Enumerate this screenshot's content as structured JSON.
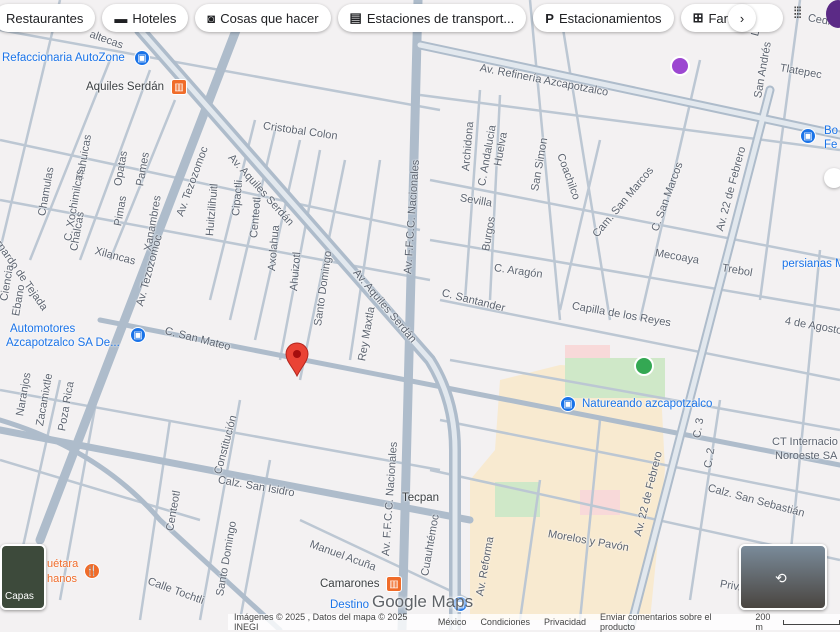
{
  "chips": [
    {
      "icon": "restaurant-icon",
      "label": "Restaurantes"
    },
    {
      "icon": "bed-icon",
      "label": "Hoteles"
    },
    {
      "icon": "camera-icon",
      "label": "Cosas que hacer"
    },
    {
      "icon": "train-icon",
      "label": "Estaciones de transport..."
    },
    {
      "icon": "parking-icon",
      "label": "Estacionamientos"
    },
    {
      "icon": "pharmacy-icon",
      "label": "Farmac"
    }
  ],
  "labels": [
    "Refaccionaria AutoZone",
    "Aquiles Serdán",
    "Cristobal Colon",
    "Av. Tezozomoc",
    "Av. Aquiles Serdán",
    "Huitzilihuitl",
    "Cipactli",
    "Centeotl",
    "Axolahua",
    "Ahuizotl",
    "Santo Domingo",
    "Tlahuicas",
    "Chamulas",
    "C. Xochimilcas",
    "Opatas",
    "Pames",
    "Pimas",
    "Chalcas",
    "Xanambres",
    "Xilancas",
    "Av. Tezozomoc",
    "Ebano",
    "Bernardo de Tejada",
    "Ciencia",
    "Automotores",
    "Azcapotzalco SA De...",
    "C. San Mateo",
    "Rey Maxtla",
    "Av. Aquiles Serdán",
    "Av. F.F.C.C. Nacionales",
    "Archidona",
    "C. Andalucia",
    "Huelva",
    "San Simon",
    "Coachilco",
    "Sevilla",
    "Burgos",
    "C. Aragón",
    "C. Santander",
    "Capilla de los Reyes",
    "Cam. San Marcos",
    "C. San Marcos",
    "Mecoaya",
    "Trebol",
    "Av. 22 de Febrero",
    "persianas M",
    "4 de Agosto",
    "Av. Refinería Azcapotzalco",
    "Tlatepec",
    "San Andrés",
    "La Era",
    "Bo",
    "Fe",
    "Natureando azcapotzalco",
    "CT Internacio",
    "Noroeste SA",
    "C. 3",
    "C. 2",
    "Calz. San Sebastián",
    "Morelos y Pavón",
    "Av. 22 de Febrero",
    "Priv. Cua",
    "Av. Reforma",
    "Cuauhtémoc",
    "Tecpan",
    "Av. F.F.C.C. Nacionales",
    "Constitución",
    "Calz. San Isidro",
    "Centeotl",
    "Santo Domingo",
    "Manuel Acuña",
    "Calle Tochtli",
    "Camarones",
    "Destino",
    "Naranjos",
    "Zacamixtle",
    "Poza Rica",
    "uétara",
    "hanos",
    "Cedros",
    "altecas"
  ],
  "layers_label": "Capas",
  "logo": "Google Maps",
  "footer": {
    "imagery": "Imágenes © 2025 , Datos del mapa © 2025 INEGI",
    "country": "México",
    "terms": "Condiciones",
    "privacy": "Privacidad",
    "feedback": "Enviar comentarios sobre el producto",
    "scale": "200 m"
  },
  "colors": {
    "pin": "#ea4335",
    "poi": "#1a73e8",
    "metro": "#f06c2a",
    "park": "#34a853"
  }
}
